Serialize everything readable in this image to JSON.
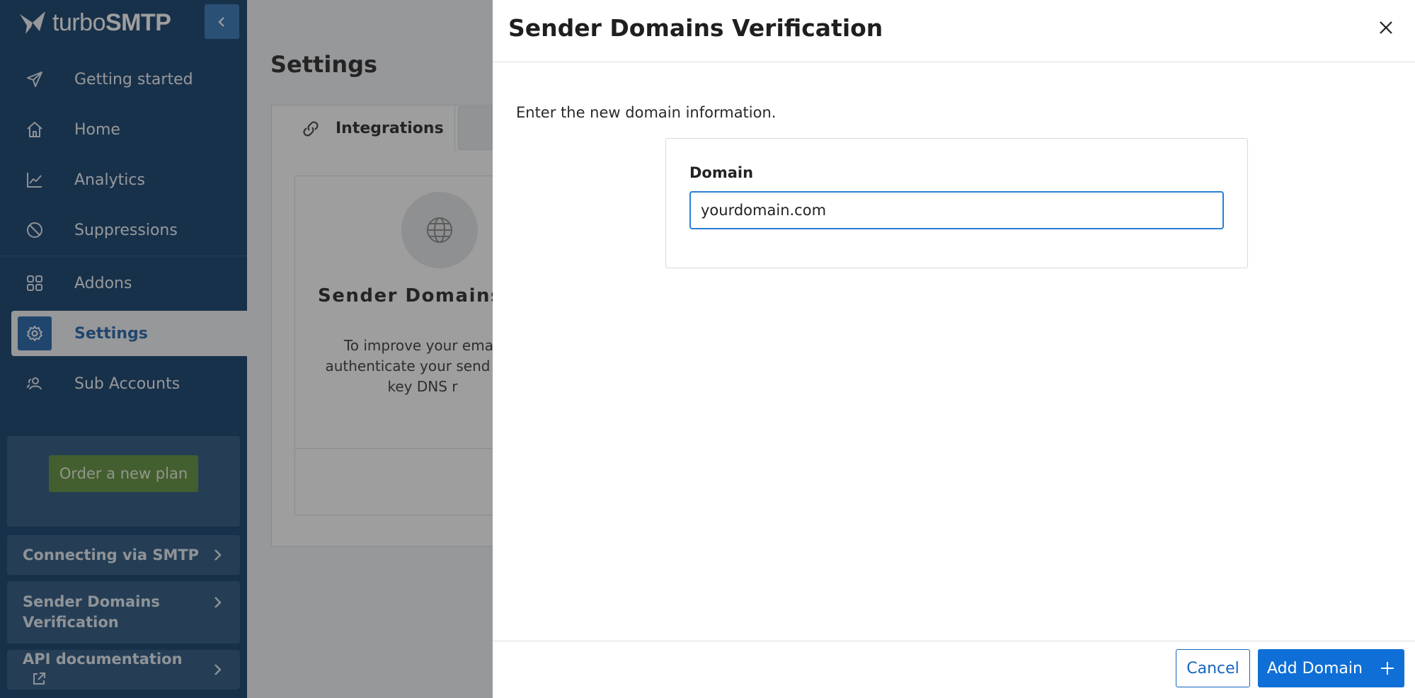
{
  "app": {
    "logo_text_light": "turbo",
    "logo_text_bold": "SMTP"
  },
  "sidebar": {
    "items": [
      {
        "label": "Getting started",
        "icon": "paper-plane-icon"
      },
      {
        "label": "Home",
        "icon": "home-icon"
      },
      {
        "label": "Analytics",
        "icon": "chart-icon"
      },
      {
        "label": "Suppressions",
        "icon": "ban-icon"
      },
      {
        "label": "Addons",
        "icon": "grid-icon"
      },
      {
        "label": "Settings",
        "icon": "gear-icon",
        "active": true
      },
      {
        "label": "Sub Accounts",
        "icon": "users-icon"
      }
    ],
    "plan_button": "Order a new plan",
    "links": [
      {
        "label": "Connecting via SMTP"
      },
      {
        "label": "Sender Domains Verification"
      },
      {
        "label": "API documentation"
      }
    ]
  },
  "main": {
    "title": "Settings",
    "tab_integrations": "Integrations",
    "card_title": "Sender Domains",
    "card_desc": "To improve your email authenticate your send few key DNS r"
  },
  "drawer": {
    "title": "Sender Domains Verification",
    "intro": "Enter the new domain information.",
    "domain_label": "Domain",
    "domain_value": "yourdomain.com",
    "cancel_label": "Cancel",
    "add_label": "Add Domain"
  },
  "colors": {
    "sidebar_bg": "#0b3a66",
    "accent": "#0f6fd6",
    "plan_green": "#5a8d35"
  }
}
